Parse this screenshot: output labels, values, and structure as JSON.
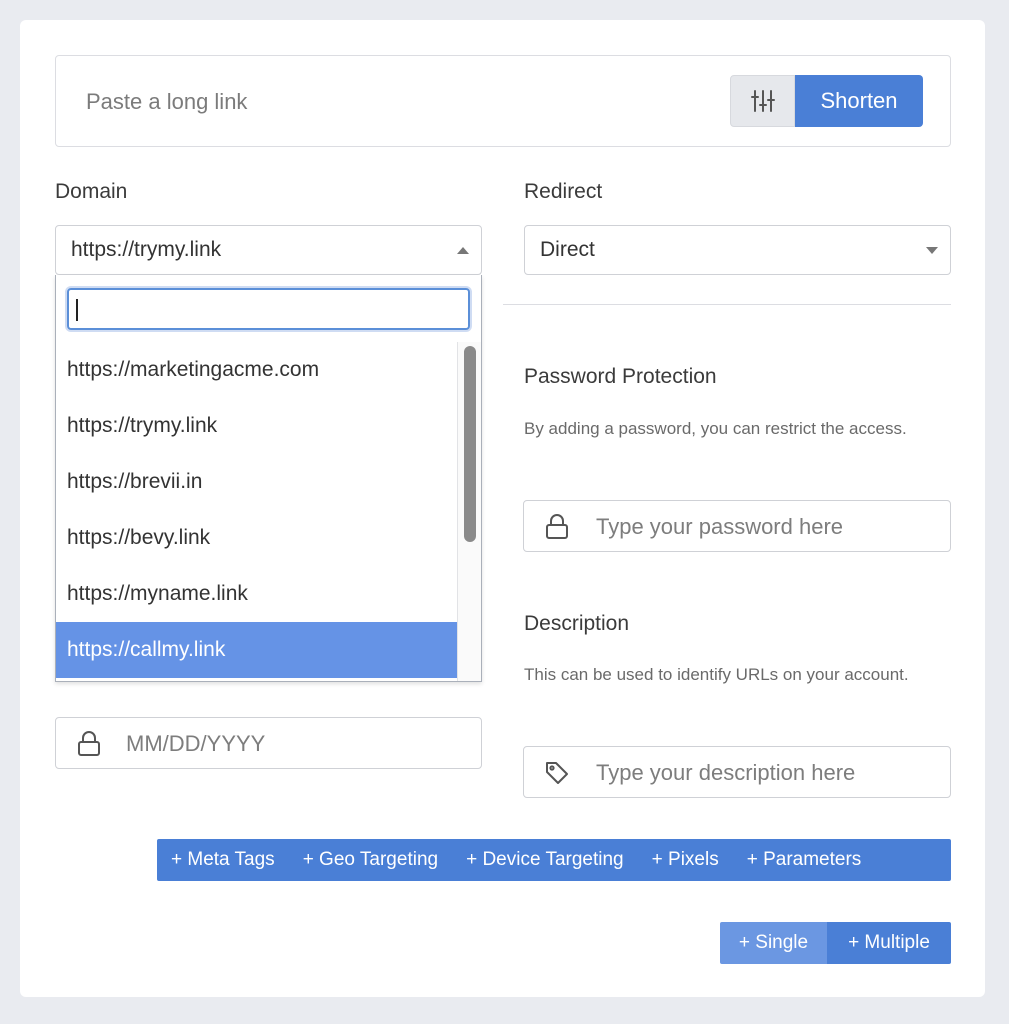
{
  "link": {
    "placeholder": "Paste a long link",
    "settings_icon": "sliders-icon",
    "shorten_label": "Shorten"
  },
  "domain": {
    "label": "Domain",
    "selected": "https://trymy.link",
    "dropdown": {
      "search_value": "",
      "options": [
        "https://marketingacme.com",
        "https://trymy.link",
        "https://brevii.in",
        "https://bevy.link",
        "https://myname.link",
        "https://callmy.link"
      ],
      "highlighted": "https://callmy.link"
    }
  },
  "redirect": {
    "label": "Redirect",
    "selected": "Direct"
  },
  "password": {
    "title": "Password Protection",
    "description": "By adding a password, you can restrict the access.",
    "placeholder": "Type your password here",
    "icon": "lock-icon"
  },
  "description": {
    "title": "Description",
    "description": "This can be used to identify URLs on your account.",
    "placeholder": "Type your description here",
    "icon": "tag-icon"
  },
  "expiration": {
    "placeholder": "MM/DD/YYYY",
    "icon": "lock-icon"
  },
  "features": {
    "meta_tags": "+ Meta Tags",
    "geo_targeting": "+ Geo Targeting",
    "device_targeting": "+ Device Targeting",
    "pixels": "+ Pixels",
    "parameters": "+ Parameters"
  },
  "mode": {
    "single": "+ Single",
    "multiple": "+ Multiple"
  },
  "colors": {
    "accent": "#4a7fd6",
    "accent_light": "#6b97e2",
    "highlight": "#6593e6",
    "background": "#e9ebf0"
  }
}
